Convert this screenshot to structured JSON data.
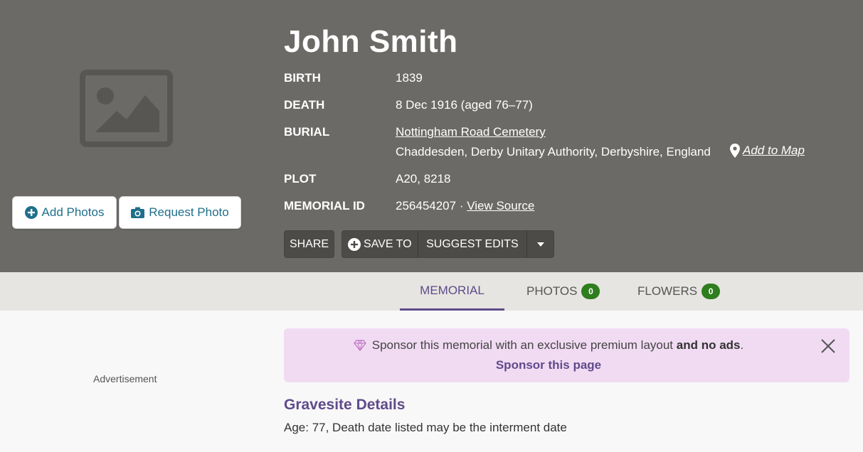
{
  "memorial": {
    "name": "John Smith",
    "birth": {
      "label": "BIRTH",
      "value": "1839"
    },
    "death": {
      "label": "DEATH",
      "value": "8 Dec 1916 (aged 76–77)"
    },
    "burial": {
      "label": "BURIAL",
      "cemetery": "Nottingham Road Cemetery",
      "location": "Chaddesden, Derby Unitary Authority, Derbyshire, England",
      "add_to_map": "Add to Map"
    },
    "plot": {
      "label": "PLOT",
      "value": "A20, 8218"
    },
    "memorial_id": {
      "label": "MEMORIAL ID",
      "value": "256454207 · ",
      "view_source": "View Source"
    }
  },
  "photo_buttons": {
    "add": "Add Photos",
    "request": "Request Photo"
  },
  "actions": {
    "share": "SHARE",
    "save_to": "SAVE TO",
    "suggest_edits": "SUGGEST EDITS"
  },
  "tabs": [
    {
      "label": "MEMORIAL"
    },
    {
      "label": "PHOTOS",
      "count": "0"
    },
    {
      "label": "FLOWERS",
      "count": "0"
    }
  ],
  "ad": {
    "label": "Advertisement"
  },
  "sponsor": {
    "text_before": "Sponsor this memorial with an exclusive premium layout ",
    "text_bold": "and no ads",
    "text_after": ".",
    "link": "Sponsor this page"
  },
  "gravesite": {
    "title": "Gravesite Details",
    "text": "Age: 77, Death date listed may be the interment date"
  },
  "colors": {
    "header_bg": "#6b6a66",
    "accent": "#5f4b8b",
    "badge": "#2e7d1e",
    "sponsor_bg": "#f1dbf3"
  },
  "icons": [
    "image-placeholder-icon",
    "plus-circle-icon",
    "camera-icon",
    "map-pin-icon",
    "caret-down-icon",
    "diamond-icon",
    "close-icon"
  ]
}
